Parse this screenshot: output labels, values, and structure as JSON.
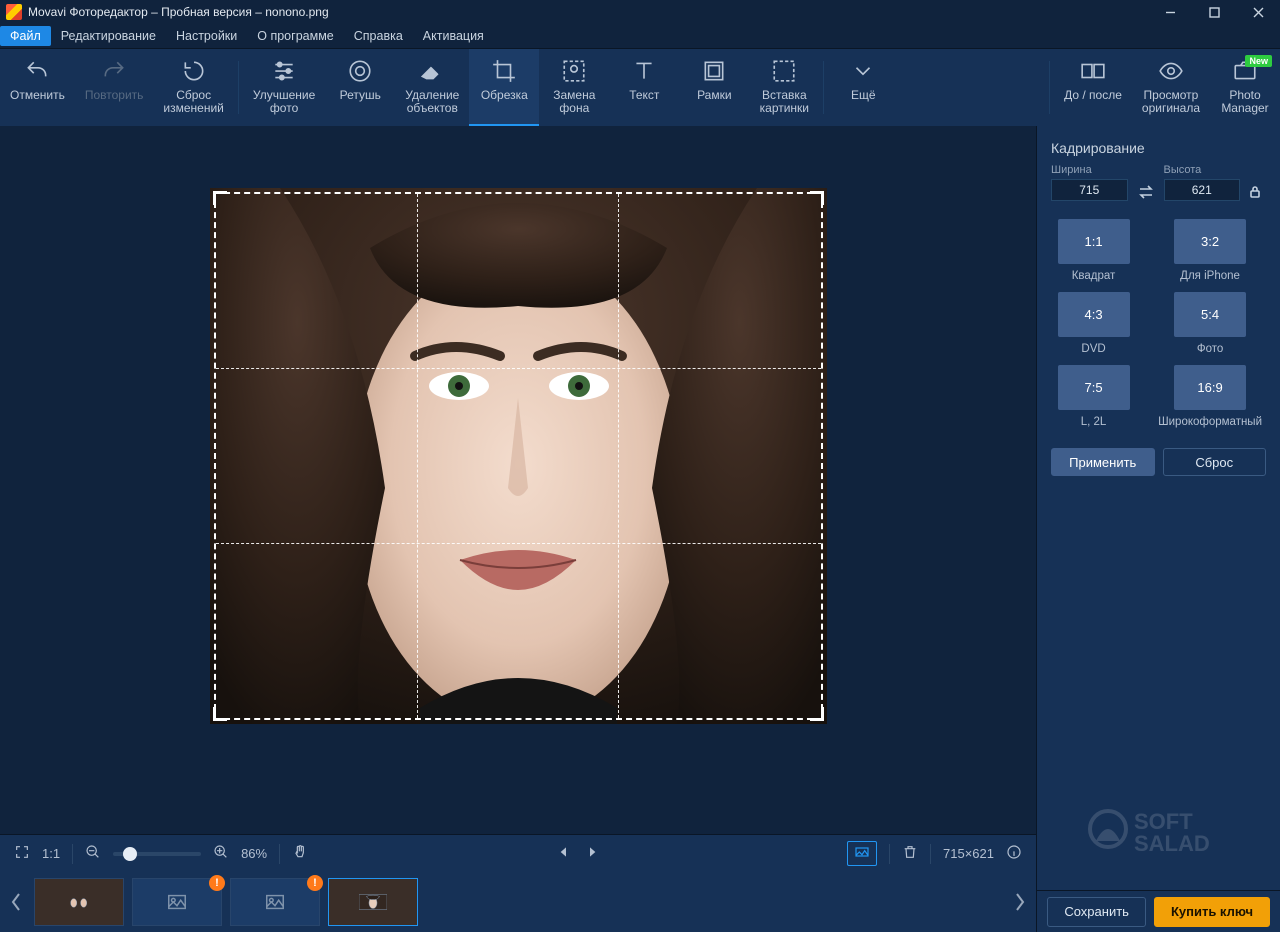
{
  "window": {
    "title": "Movavi Фоторедактор – Пробная версия – nonono.png"
  },
  "menu": {
    "file": "Файл",
    "edit": "Редактирование",
    "settings": "Настройки",
    "about": "О программе",
    "help": "Справка",
    "activation": "Активация"
  },
  "toolbar": {
    "undo": "Отменить",
    "redo": "Повторить",
    "reset": "Сброс\nизменений",
    "enhance": "Улучшение\nфото",
    "retouch": "Ретушь",
    "remove": "Удаление\nобъектов",
    "crop": "Обрезка",
    "bgswap": "Замена\nфона",
    "text": "Текст",
    "frames": "Рамки",
    "insert": "Вставка\nкартинки",
    "more": "Ещё",
    "compare": "До / после",
    "original": "Просмотр\nоригинала",
    "manager": "Photo\nManager",
    "new": "New"
  },
  "crop": {
    "title": "Кадрирование",
    "width_label": "Ширина",
    "height_label": "Высота",
    "width": "715",
    "height": "621",
    "ratios": [
      {
        "r": "1:1",
        "l": "Квадрат"
      },
      {
        "r": "3:2",
        "l": "Для iPhone"
      },
      {
        "r": "4:3",
        "l": "DVD"
      },
      {
        "r": "5:4",
        "l": "Фото"
      },
      {
        "r": "7:5",
        "l": "L, 2L"
      },
      {
        "r": "16:9",
        "l": "Широкоформатный"
      }
    ],
    "apply": "Применить",
    "reset": "Сброс"
  },
  "statusbar": {
    "zoom_label": "1:1",
    "zoom": "86%",
    "dims": "715×621"
  },
  "actions": {
    "save": "Сохранить",
    "buy": "Купить ключ"
  }
}
